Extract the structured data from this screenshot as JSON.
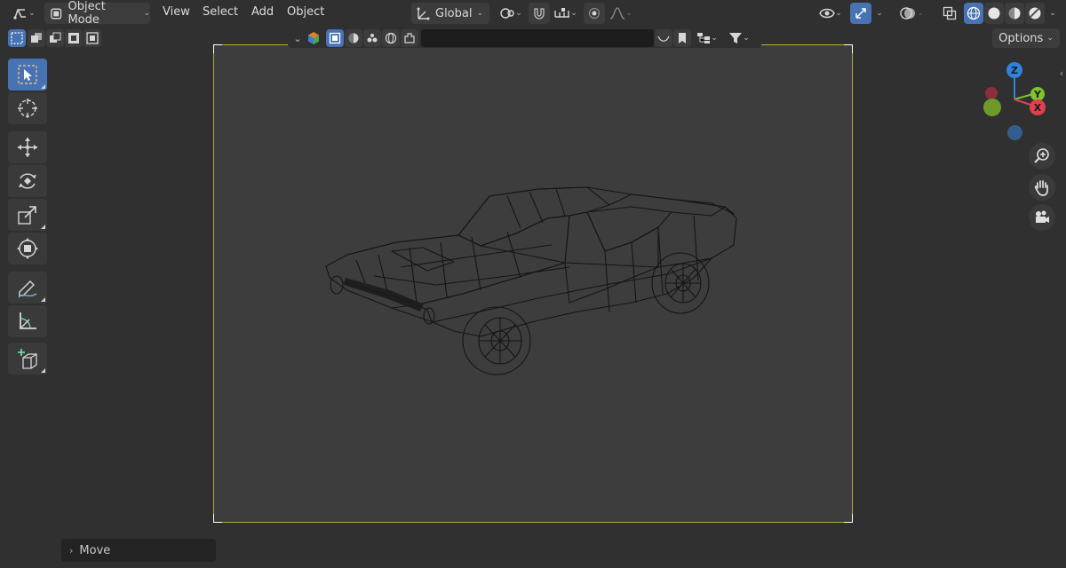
{
  "header": {
    "mode_label": "Object Mode",
    "menus": [
      "View",
      "Select",
      "Add",
      "Object"
    ],
    "transform_orientation": "Global"
  },
  "viewport_header": {
    "search_placeholder": "",
    "options_label": "Options"
  },
  "gizmo": {
    "z_label": "Z",
    "y_label": "Y",
    "x_label": "X",
    "colors": {
      "x": "#e3404f",
      "y": "#7ec42c",
      "z": "#2f83dd"
    }
  },
  "operator_panel": {
    "label": "Move"
  },
  "colors": {
    "accent": "#4772b3",
    "background": "#303030",
    "camera_border": "#b9a932",
    "camera_fill": "#3d3d3d"
  }
}
